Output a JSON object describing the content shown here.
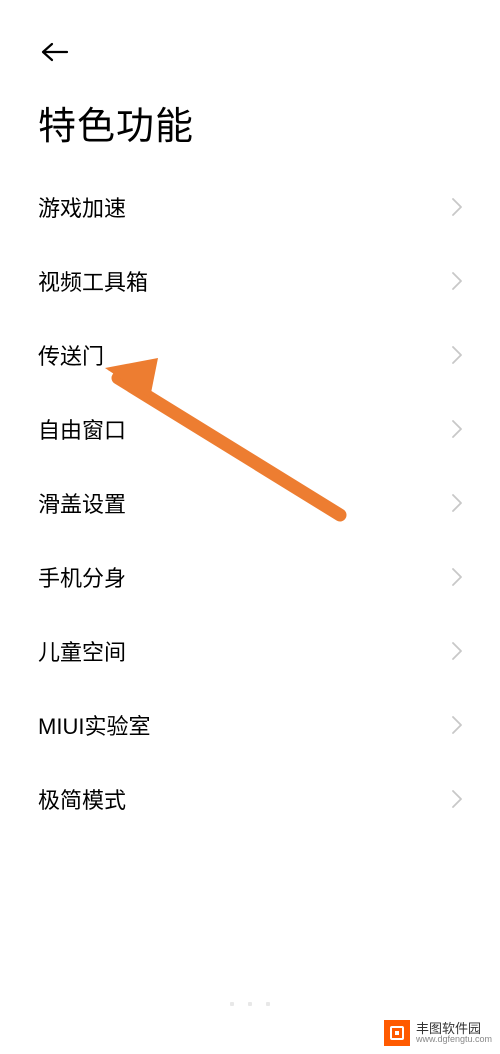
{
  "header": {
    "title": "特色功能"
  },
  "list": {
    "items": [
      {
        "label": "游戏加速"
      },
      {
        "label": "视频工具箱"
      },
      {
        "label": "传送门"
      },
      {
        "label": "自由窗口"
      },
      {
        "label": "滑盖设置"
      },
      {
        "label": "手机分身"
      },
      {
        "label": "儿童空间"
      },
      {
        "label": "MIUI实验室"
      },
      {
        "label": "极简模式"
      }
    ]
  },
  "watermark": {
    "name": "丰图软件园",
    "url": "www.dgfengtu.com"
  },
  "annotation": {
    "arrow_color": "#ed7d31",
    "target_item_index": 2
  }
}
